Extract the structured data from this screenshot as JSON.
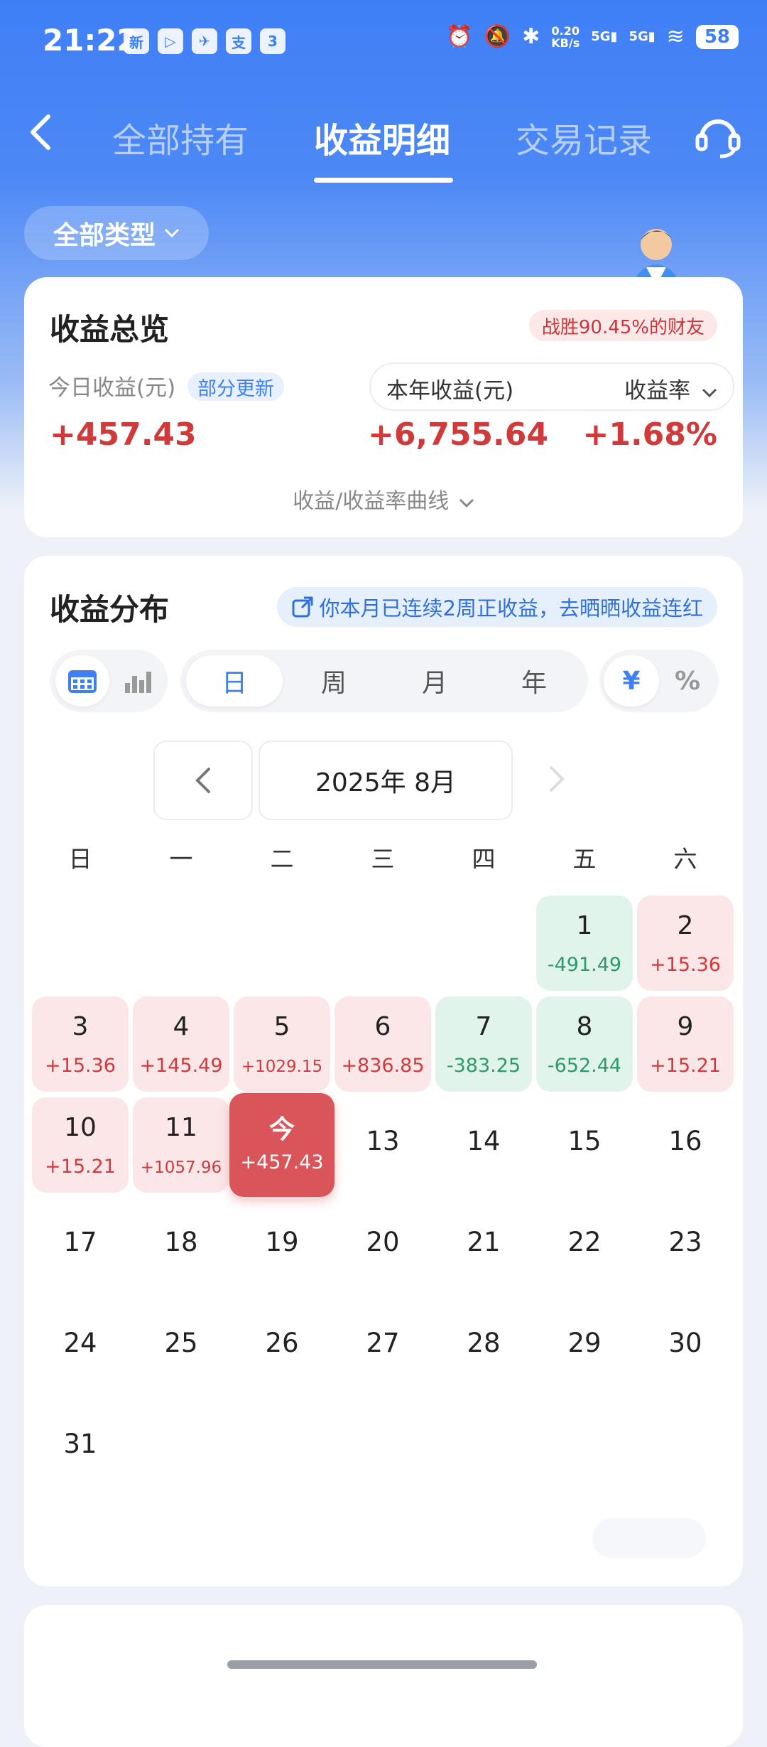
{
  "status_bar": {
    "time": "21:22",
    "app_icons": [
      "新",
      "▷",
      "✈",
      "支",
      "3"
    ],
    "net_speed_value": "0.20",
    "net_speed_unit": "KB/s",
    "sig1": "5G",
    "sig2": "5G",
    "battery": "58"
  },
  "nav": {
    "tabs": [
      {
        "label": "全部持有",
        "active": false
      },
      {
        "label": "收益明细",
        "active": true
      },
      {
        "label": "交易记录",
        "active": false
      }
    ]
  },
  "filter": {
    "label": "全部类型"
  },
  "overview": {
    "title": "收益总览",
    "beat_badge": "战胜90.45%的财友",
    "today_label": "今日收益(元)",
    "partial_badge": "部分更新",
    "year_label": "本年收益(元)",
    "rate_label": "收益率",
    "today_value": "+457.43",
    "year_value": "+6,755.64",
    "rate_value": "+1.68%",
    "curve_link": "收益/收益率曲线"
  },
  "distribution": {
    "title": "收益分布",
    "streak_text": "你本月已连续2周正收益，去晒晒收益连红",
    "periods": [
      {
        "label": "日",
        "active": true
      },
      {
        "label": "周",
        "active": false
      },
      {
        "label": "月",
        "active": false
      },
      {
        "label": "年",
        "active": false
      }
    ],
    "unit_yuan": "¥",
    "unit_pct": "%",
    "month": "2025年 8月",
    "weekdays": [
      "日",
      "一",
      "二",
      "三",
      "四",
      "五",
      "六"
    ]
  },
  "calendar": {
    "days": [
      {
        "d": "1",
        "v": "-491.49",
        "t": "neg",
        "col": 5,
        "row": 0
      },
      {
        "d": "2",
        "v": "+15.36",
        "t": "pos",
        "col": 6,
        "row": 0
      },
      {
        "d": "3",
        "v": "+15.36",
        "t": "pos",
        "col": 0,
        "row": 1
      },
      {
        "d": "4",
        "v": "+145.49",
        "t": "pos",
        "col": 1,
        "row": 1
      },
      {
        "d": "5",
        "v": "+1029.15",
        "t": "pos",
        "col": 2,
        "row": 1
      },
      {
        "d": "6",
        "v": "+836.85",
        "t": "pos",
        "col": 3,
        "row": 1
      },
      {
        "d": "7",
        "v": "-383.25",
        "t": "neg",
        "col": 4,
        "row": 1
      },
      {
        "d": "8",
        "v": "-652.44",
        "t": "neg",
        "col": 5,
        "row": 1
      },
      {
        "d": "9",
        "v": "+15.21",
        "t": "pos",
        "col": 6,
        "row": 1
      },
      {
        "d": "10",
        "v": "+15.21",
        "t": "pos",
        "col": 0,
        "row": 2
      },
      {
        "d": "11",
        "v": "+1057.96",
        "t": "pos",
        "col": 1,
        "row": 2
      },
      {
        "d": "今",
        "v": "+457.43",
        "t": "today",
        "col": 2,
        "row": 2
      },
      {
        "d": "13",
        "v": "",
        "t": "plain",
        "col": 3,
        "row": 2
      },
      {
        "d": "14",
        "v": "",
        "t": "plain",
        "col": 4,
        "row": 2
      },
      {
        "d": "15",
        "v": "",
        "t": "plain",
        "col": 5,
        "row": 2
      },
      {
        "d": "16",
        "v": "",
        "t": "plain",
        "col": 6,
        "row": 2
      },
      {
        "d": "17",
        "v": "",
        "t": "plain",
        "col": 0,
        "row": 3
      },
      {
        "d": "18",
        "v": "",
        "t": "plain",
        "col": 1,
        "row": 3
      },
      {
        "d": "19",
        "v": "",
        "t": "plain",
        "col": 2,
        "row": 3
      },
      {
        "d": "20",
        "v": "",
        "t": "plain",
        "col": 3,
        "row": 3
      },
      {
        "d": "21",
        "v": "",
        "t": "plain",
        "col": 4,
        "row": 3
      },
      {
        "d": "22",
        "v": "",
        "t": "plain",
        "col": 5,
        "row": 3
      },
      {
        "d": "23",
        "v": "",
        "t": "plain",
        "col": 6,
        "row": 3
      },
      {
        "d": "24",
        "v": "",
        "t": "plain",
        "col": 0,
        "row": 4
      },
      {
        "d": "25",
        "v": "",
        "t": "plain",
        "col": 1,
        "row": 4
      },
      {
        "d": "26",
        "v": "",
        "t": "plain",
        "col": 2,
        "row": 4
      },
      {
        "d": "27",
        "v": "",
        "t": "plain",
        "col": 3,
        "row": 4
      },
      {
        "d": "28",
        "v": "",
        "t": "plain",
        "col": 4,
        "row": 4
      },
      {
        "d": "29",
        "v": "",
        "t": "plain",
        "col": 5,
        "row": 4
      },
      {
        "d": "30",
        "v": "",
        "t": "plain",
        "col": 6,
        "row": 4
      },
      {
        "d": "31",
        "v": "",
        "t": "plain",
        "col": 0,
        "row": 5
      }
    ]
  },
  "colors": {
    "brand_blue": "#3f7ff6",
    "gain_red": "#d13a3a",
    "loss_green": "#2e9a6a",
    "today_red": "#d95559"
  }
}
